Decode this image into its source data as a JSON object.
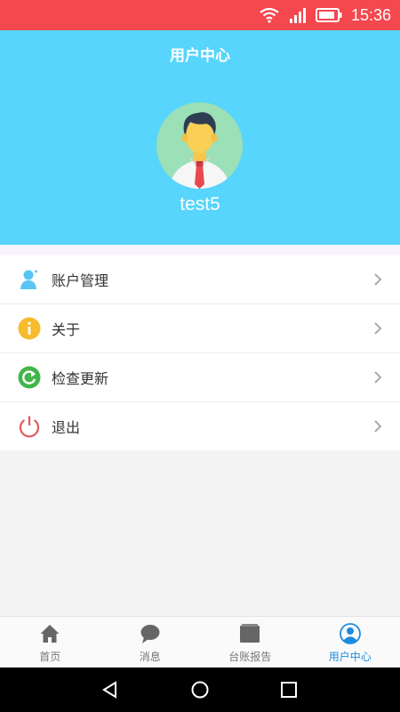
{
  "status_bar": {
    "time": "15:36",
    "icons": [
      "wifi-icon",
      "signal-icon",
      "battery-icon"
    ],
    "background": "#f4474e"
  },
  "header": {
    "title": "用户中心",
    "username": "test5",
    "background": "#57d5fc"
  },
  "menu": [
    {
      "label": "账户管理",
      "icon": "account-icon"
    },
    {
      "label": "关于",
      "icon": "info-icon"
    },
    {
      "label": "检查更新",
      "icon": "refresh-icon"
    },
    {
      "label": "退出",
      "icon": "power-icon"
    }
  ],
  "tabbar": {
    "items": [
      {
        "label": "首页",
        "icon": "home-icon"
      },
      {
        "label": "消息",
        "icon": "message-icon"
      },
      {
        "label": "台账报告",
        "icon": "folder-icon"
      },
      {
        "label": "用户中心",
        "icon": "user-icon"
      }
    ],
    "active_index": 3,
    "active_color": "#1a8ce0"
  }
}
